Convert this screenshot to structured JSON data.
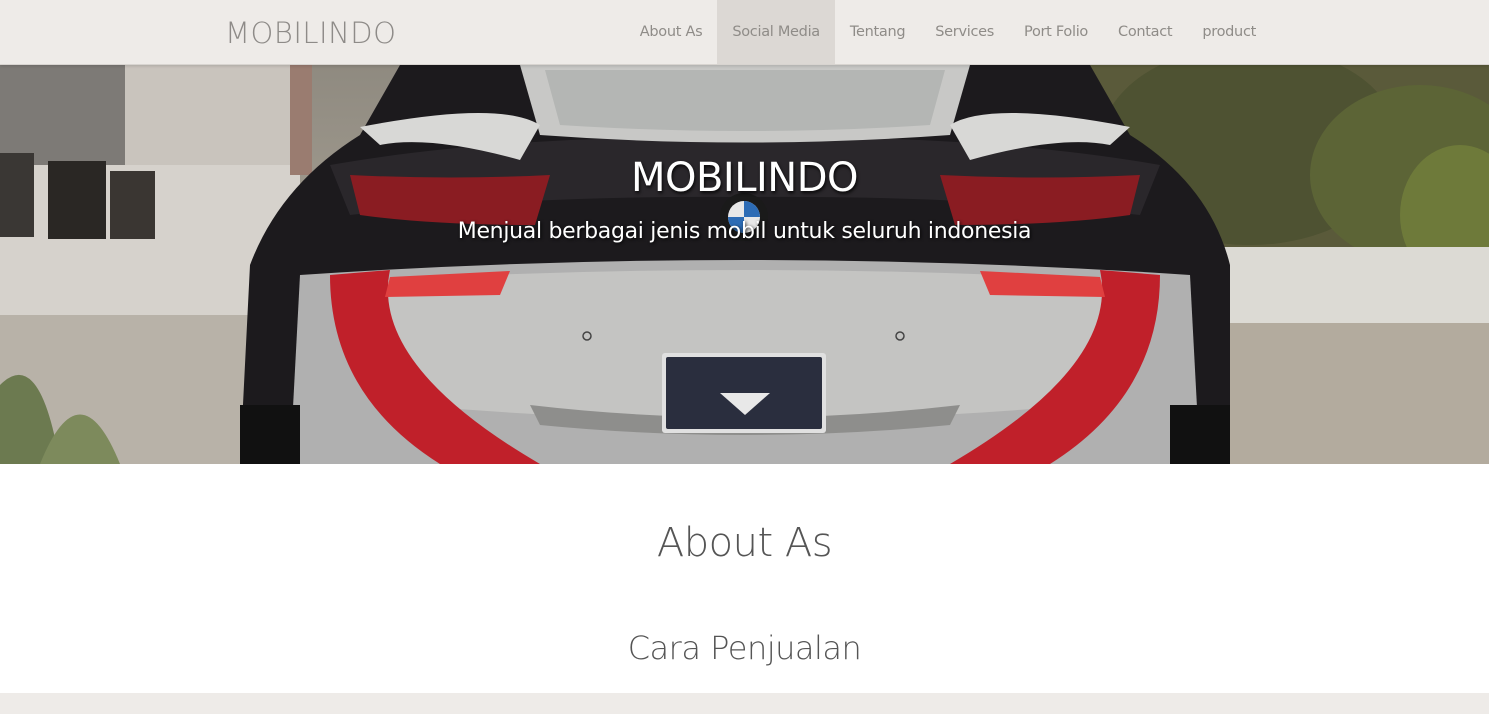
{
  "navbar": {
    "brand": "MOBILINDO",
    "items": [
      {
        "label": "About As",
        "active": false
      },
      {
        "label": "Social Media",
        "active": true
      },
      {
        "label": "Tentang",
        "active": false
      },
      {
        "label": "Services",
        "active": false
      },
      {
        "label": "Port Folio",
        "active": false
      },
      {
        "label": "Contact",
        "active": false
      },
      {
        "label": "product",
        "active": false
      }
    ]
  },
  "hero": {
    "title": "MOBILINDO",
    "subtitle": "Menjual berbagai jenis mobil untuk seluruh indonesia",
    "image": "car-rear-photo"
  },
  "about": {
    "title": "About As",
    "subtitle": "Cara Penjualan"
  },
  "colors": {
    "navbar_bg": "#eeebe8",
    "active_bg": "#dcd8d4",
    "nav_text": "#8f8c88",
    "car_red": "#c0202a"
  }
}
